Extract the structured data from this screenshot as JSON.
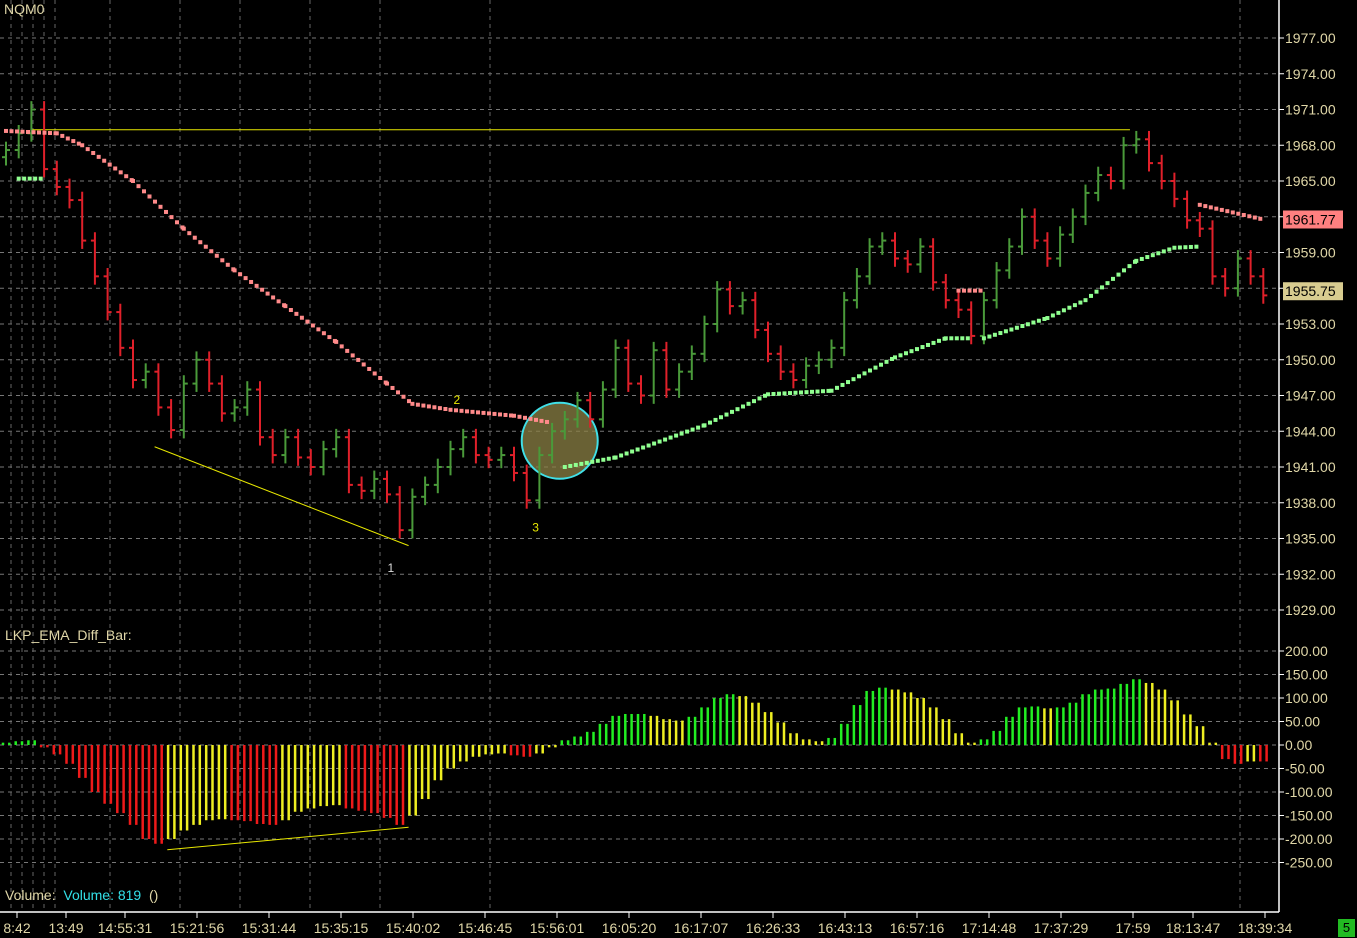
{
  "symbol": "NQM0",
  "indicator_label": "LKP_EMA_Diff_Bar:",
  "volume": {
    "label": "Volume:",
    "value_text": "Volume: 819",
    "extra": "()"
  },
  "status_box": "5",
  "colors": {
    "up": "#4a9a3a",
    "down": "#e0202a",
    "ema_slow": "#ff8a8a",
    "ema_fast": "#90ff90",
    "hist_green": "#22ee22",
    "hist_yellow": "#eeee22",
    "hist_red": "#ee1a1a",
    "annotation": "#e8e800",
    "circle": "#40e0e8",
    "axis_text": "#e0d7a8"
  },
  "chart_data": [
    {
      "type": "ohlc",
      "title": "NQM0",
      "ylim": [
        1927,
        1980
      ],
      "y_ticks": [
        "1977.00",
        "1974.00",
        "1971.00",
        "1968.00",
        "1965.00",
        "1962.00",
        "1959.00",
        "1956.00",
        "1953.00",
        "1950.00",
        "1947.00",
        "1944.00",
        "1941.00",
        "1938.00",
        "1935.00",
        "1932.00",
        "1929.00"
      ],
      "x_ticks": [
        "8:42",
        "13:49",
        "14:55:31",
        "15:21:56",
        "15:31:44",
        "15:35:15",
        "15:40:02",
        "15:46:45",
        "15:56:01",
        "16:05:20",
        "16:17:07",
        "16:26:33",
        "16:43:13",
        "16:57:16",
        "17:14:48",
        "17:37:29",
        "17:59",
        "18:13:47",
        "18:39:34"
      ],
      "closes": [
        1967.6,
        1969,
        1971,
        1966,
        1964.5,
        1963.4,
        1960,
        1957,
        1954,
        1951,
        1948.3,
        1949,
        1946,
        1944.1,
        1948,
        1950,
        1948,
        1945.5,
        1946,
        1947.5,
        1943.5,
        1942,
        1943.5,
        1941.8,
        1941,
        1942.5,
        1943.5,
        1939.5,
        1939,
        1940,
        1938.7,
        1935.7,
        1938.5,
        1939.5,
        1941,
        1942.5,
        1943.5,
        1942,
        1941.6,
        1942,
        1940.5,
        1938.2,
        1942,
        1944,
        1945,
        1946.6,
        1945,
        1947.5,
        1951,
        1948,
        1947,
        1950.8,
        1947.5,
        1949,
        1950.5,
        1953,
        1955.9,
        1954.5,
        1955,
        1952.5,
        1950.5,
        1949,
        1948.3,
        1949.5,
        1950,
        1951,
        1955,
        1957,
        1959.5,
        1960,
        1958.5,
        1958,
        1959.5,
        1956.5,
        1955,
        1954.2,
        1952,
        1955,
        1957.5,
        1959.5,
        1962,
        1960,
        1958.5,
        1960.5,
        1962,
        1964,
        1965.5,
        1965,
        1968,
        1968.5,
        1966.5,
        1965,
        1963.5,
        1961.7,
        1961,
        1957,
        1956,
        1958.5,
        1957,
        1955.4
      ],
      "ema_slow_segments": [
        [
          [
            0,
            1969.2
          ],
          [
            4,
            1969
          ],
          [
            6,
            1968
          ],
          [
            10,
            1965
          ],
          [
            14,
            1961
          ],
          [
            18,
            1957.5
          ],
          [
            22,
            1954.5
          ],
          [
            26,
            1951.5
          ],
          [
            30,
            1948
          ],
          [
            32,
            1946.3
          ],
          [
            35,
            1945.8
          ],
          [
            40,
            1945.3
          ],
          [
            43,
            1944.7
          ]
        ],
        [
          [
            75,
            1955.8
          ],
          [
            77,
            1955.8
          ]
        ],
        [
          [
            94,
            1963
          ],
          [
            99,
            1961.77
          ]
        ]
      ],
      "ema_fast_segments": [
        [
          [
            1,
            1965.2
          ],
          [
            3,
            1965.2
          ]
        ],
        [
          [
            44,
            1941
          ],
          [
            48,
            1941.8
          ],
          [
            55,
            1944.5
          ],
          [
            60,
            1947.1
          ],
          [
            65,
            1947.4
          ],
          [
            70,
            1950.2
          ],
          [
            74,
            1951.8
          ],
          [
            76,
            1951.8
          ]
        ],
        [
          [
            77,
            1951.8
          ],
          [
            82,
            1953.5
          ],
          [
            85,
            1955
          ],
          [
            89,
            1958.3
          ],
          [
            92,
            1959.4
          ],
          [
            94,
            1959.5
          ]
        ]
      ],
      "last_price_labels": [
        {
          "text": "1961.77",
          "value": 1961.77,
          "bg": "#ff8080"
        },
        {
          "text": "1955.75",
          "value": 1955.75,
          "bg": "#d8cc90"
        }
      ],
      "annotations": {
        "resistance": {
          "from": [
            2,
            1969.3
          ],
          "to": [
            88.5,
            1969.3
          ]
        },
        "trendline": {
          "from": [
            11.7,
            1942.7
          ],
          "to": [
            31.7,
            1934.4
          ]
        },
        "labels": [
          {
            "text": "1",
            "at": [
              30.3,
              1932.2
            ]
          },
          {
            "text": "2",
            "at": [
              35.5,
              1946.3
            ]
          },
          {
            "text": "3",
            "at": [
              41.7,
              1935.6
            ]
          }
        ],
        "circle_center": [
          43.6,
          1943.2
        ]
      }
    },
    {
      "type": "bar",
      "title": "LKP_EMA_Diff_Bar",
      "ylim": [
        -290,
        220
      ],
      "y_ticks": [
        "200.00",
        "150.00",
        "100.00",
        "50.00",
        "0.00",
        "-50.00",
        "-100.00",
        "-150.00",
        "-200.00",
        "-250.00"
      ],
      "values": [
        5,
        8,
        10,
        -5,
        -20,
        -40,
        -70,
        -100,
        -125,
        -145,
        -170,
        -200,
        -210,
        -200,
        -182,
        -170,
        -160,
        -158,
        -160,
        -162,
        -168,
        -170,
        -160,
        -142,
        -135,
        -130,
        -128,
        -135,
        -140,
        -145,
        -155,
        -170,
        -150,
        -115,
        -75,
        -50,
        -35,
        -25,
        -20,
        -18,
        -22,
        -25,
        -18,
        -5,
        10,
        18,
        28,
        45,
        62,
        66,
        66,
        62,
        55,
        52,
        60,
        80,
        100,
        108,
        104,
        90,
        70,
        48,
        25,
        12,
        8,
        15,
        45,
        85,
        115,
        122,
        118,
        112,
        100,
        80,
        55,
        25,
        5,
        12,
        30,
        60,
        80,
        82,
        78,
        80,
        90,
        108,
        118,
        120,
        130,
        140,
        132,
        118,
        95,
        65,
        40,
        5,
        -30,
        -40,
        -35,
        -35
      ],
      "trendline": {
        "from": [
          12.7,
          -223
        ],
        "to": [
          31.7,
          -175
        ]
      }
    }
  ]
}
